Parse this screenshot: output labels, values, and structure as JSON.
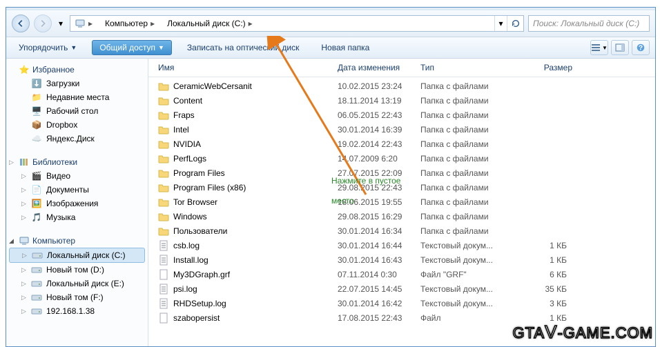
{
  "breadcrumb": {
    "seg1": "Компьютер",
    "seg2": "Локальный диск (C:)"
  },
  "search": {
    "placeholder": "Поиск: Локальный диск (C:)"
  },
  "toolbar": {
    "organize": "Упорядочить",
    "share": "Общий доступ",
    "burn": "Записать на оптический диск",
    "newfolder": "Новая папка"
  },
  "columns": {
    "name": "Имя",
    "date": "Дата изменения",
    "type": "Тип",
    "size": "Размер"
  },
  "sidebar": {
    "fav": "Избранное",
    "fav_items": [
      "Загрузки",
      "Недавние места",
      "Рабочий стол",
      "Dropbox",
      "Яндекс.Диск"
    ],
    "lib": "Библиотеки",
    "lib_items": [
      "Видео",
      "Документы",
      "Изображения",
      "Музыка"
    ],
    "comp": "Компьютер",
    "comp_items": [
      "Локальный диск (C:)",
      "Новый том (D:)",
      "Локальный диск (E:)",
      "Новый том (F:)",
      "192.168.1.38"
    ]
  },
  "files": [
    {
      "n": "CeramicWebCersanit",
      "d": "10.02.2015 23:24",
      "t": "Папка с файлами",
      "s": "",
      "ic": "folder"
    },
    {
      "n": "Content",
      "d": "18.11.2014 13:19",
      "t": "Папка с файлами",
      "s": "",
      "ic": "folder"
    },
    {
      "n": "Fraps",
      "d": "06.05.2015 22:43",
      "t": "Папка с файлами",
      "s": "",
      "ic": "folder"
    },
    {
      "n": "Intel",
      "d": "30.01.2014 16:39",
      "t": "Папка с файлами",
      "s": "",
      "ic": "folder"
    },
    {
      "n": "NVIDIA",
      "d": "19.02.2014 22:43",
      "t": "Папка с файлами",
      "s": "",
      "ic": "folder"
    },
    {
      "n": "PerfLogs",
      "d": "14.07.2009 6:20",
      "t": "Папка с файлами",
      "s": "",
      "ic": "folder"
    },
    {
      "n": "Program Files",
      "d": "27.07.2015 22:09",
      "t": "Папка с файлами",
      "s": "",
      "ic": "folder"
    },
    {
      "n": "Program Files (x86)",
      "d": "29.08.2015 22:43",
      "t": "Папка с файлами",
      "s": "",
      "ic": "folder"
    },
    {
      "n": "Tor Browser",
      "d": "18.06.2015 19:55",
      "t": "Папка с файлами",
      "s": "",
      "ic": "folder"
    },
    {
      "n": "Windows",
      "d": "29.08.2015 16:29",
      "t": "Папка с файлами",
      "s": "",
      "ic": "folder"
    },
    {
      "n": "Пользователи",
      "d": "30.01.2014 16:34",
      "t": "Папка с файлами",
      "s": "",
      "ic": "folder"
    },
    {
      "n": "csb.log",
      "d": "30.01.2014 16:44",
      "t": "Текстовый докум...",
      "s": "1 КБ",
      "ic": "txt"
    },
    {
      "n": "Install.log",
      "d": "30.01.2014 16:43",
      "t": "Текстовый докум...",
      "s": "1 КБ",
      "ic": "txt"
    },
    {
      "n": "My3DGraph.grf",
      "d": "07.11.2014 0:30",
      "t": "Файл \"GRF\"",
      "s": "6 КБ",
      "ic": "file"
    },
    {
      "n": "psi.log",
      "d": "22.07.2015 14:45",
      "t": "Текстовый докум...",
      "s": "35 КБ",
      "ic": "txt"
    },
    {
      "n": "RHDSetup.log",
      "d": "30.01.2014 16:42",
      "t": "Текстовый докум...",
      "s": "3 КБ",
      "ic": "txt"
    },
    {
      "n": "szabopersist",
      "d": "17.08.2015 22:43",
      "t": "Файл",
      "s": "1 КБ",
      "ic": "file"
    }
  ],
  "annotation": {
    "line1": "Нажмите в пустое",
    "line2": "место"
  },
  "watermark": "GTA V -GAME.COM"
}
